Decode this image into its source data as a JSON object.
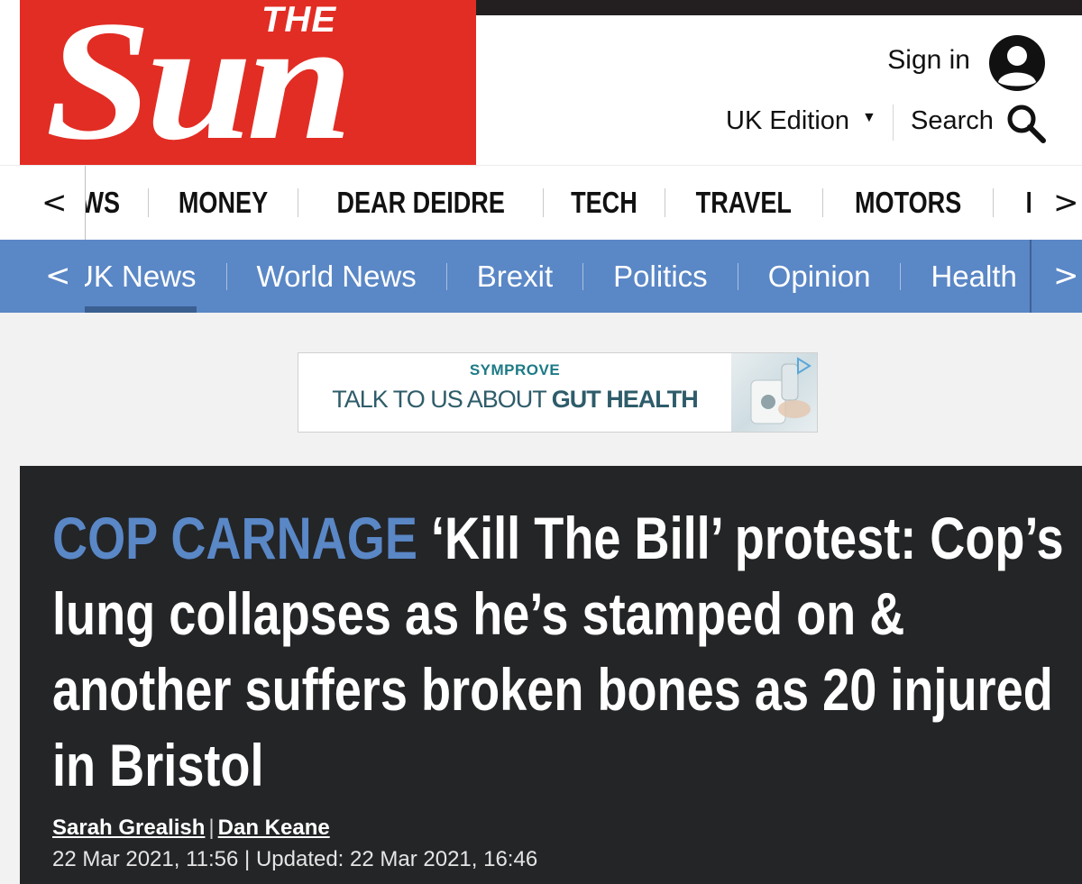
{
  "header": {
    "logo": {
      "small": "THE",
      "big": "Sun"
    },
    "sign_in_label": "Sign in",
    "edition_label": "UK Edition",
    "search_label": "Search",
    "brand_red": "#e22d24"
  },
  "section_nav": {
    "items": [
      "NEWS",
      "MONEY",
      "DEAR DEIDRE",
      "TECH",
      "TRAVEL",
      "MOTORS",
      "PUZZLES"
    ],
    "prev_arrow": "<",
    "next_arrow": ">"
  },
  "sub_nav": {
    "items": [
      "UK News",
      "World News",
      "Brexit",
      "Politics",
      "Opinion",
      "Health"
    ],
    "active_index": 0,
    "prev_arrow": "<",
    "next_arrow": ">",
    "color": "#5a87c6"
  },
  "ad": {
    "brand": "SYMPROVE",
    "line_pre": "TALK TO US ABOUT ",
    "line_bold": "GUT HEALTH"
  },
  "article": {
    "kicker": "COP CARNAGE",
    "headline": "‘Kill The Bill’ protest: Cop’s lung collapses as he’s stamped on & another suffers broken bones as 20 injured in Bristol",
    "authors": [
      "Sarah Grealish",
      "Dan Keane"
    ],
    "author_separator": "|",
    "dateline": "22 Mar 2021, 11:56 | Updated: 22 Mar 2021, 16:46",
    "kicker_color": "#5a87c6"
  }
}
